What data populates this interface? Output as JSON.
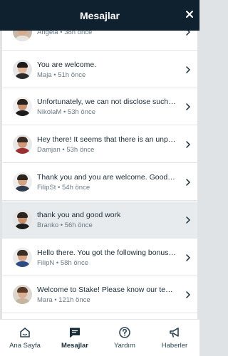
{
  "header": {
    "title": "Mesajlar",
    "close_icon": "close-icon"
  },
  "messages": [
    {
      "text": "",
      "sender": "Angela",
      "age": "38h önce",
      "avatar_bg": "#c9b8a8",
      "skin": "#d9a98c",
      "hair": "#3b2a20",
      "shirt": "#e8e4df",
      "active": false
    },
    {
      "text": "You are welcome.",
      "sender": "Maja",
      "age": "51h önce",
      "avatar_bg": "#e6e6e6",
      "skin": "#e2b59a",
      "hair": "#1e1a18",
      "shirt": "#2b2b2b",
      "active": false
    },
    {
      "text": "Unfortunately, we can not disclose such in...",
      "sender": "NikolaM",
      "age": "53h önce",
      "avatar_bg": "#efefef",
      "skin": "#c89274",
      "hair": "#2a211c",
      "shirt": "#1c1c1c",
      "active": false
    },
    {
      "text": "Hey there! It seems that there is an unpla...",
      "sender": "Damjan",
      "age": "53h önce",
      "avatar_bg": "#e8e8e8",
      "skin": "#cf9a7c",
      "hair": "#3a2a22",
      "shirt": "#9c2f2f",
      "active": false
    },
    {
      "text": "Thank you and you are welcome. Good lu...",
      "sender": "FilipSt",
      "age": "54h önce",
      "avatar_bg": "#eeeeee",
      "skin": "#d4a183",
      "hair": "#2e241e",
      "shirt": "#2d3b4c",
      "active": false
    },
    {
      "text": "thank you and good work",
      "sender": "Branko",
      "age": "56h önce",
      "avatar_bg": "#e4e4e4",
      "skin": "#c6906f",
      "hair": "#2b2420",
      "shirt": "#1d1d1d",
      "active": true
    },
    {
      "text": "Hello there. You got the following bonuse...",
      "sender": "FilipN",
      "age": "58h önce",
      "avatar_bg": "#ececec",
      "skin": "#d7a486",
      "hair": "#3b2e25",
      "shirt": "#2c4a86",
      "active": false
    },
    {
      "text": "Welcome to Stake! Please know our team ...",
      "sender": "Mara",
      "age": "121h önce",
      "avatar_bg": "#dcd6cf",
      "skin": "#dcae92",
      "hair": "#5a3a26",
      "shirt": "#c7b49f",
      "active": false
    }
  ],
  "footer": {
    "items": [
      {
        "label": "Ana Sayfa",
        "icon": "home-icon",
        "active": false
      },
      {
        "label": "Mesajlar",
        "icon": "chat-icon",
        "active": true
      },
      {
        "label": "Yardım",
        "icon": "help-icon",
        "active": false
      },
      {
        "label": "Haberler",
        "icon": "megaphone-icon",
        "active": false
      }
    ]
  },
  "colors": {
    "header_bg": "#0f212e",
    "text_primary": "#1a2c38",
    "text_secondary": "#6b7a85"
  }
}
